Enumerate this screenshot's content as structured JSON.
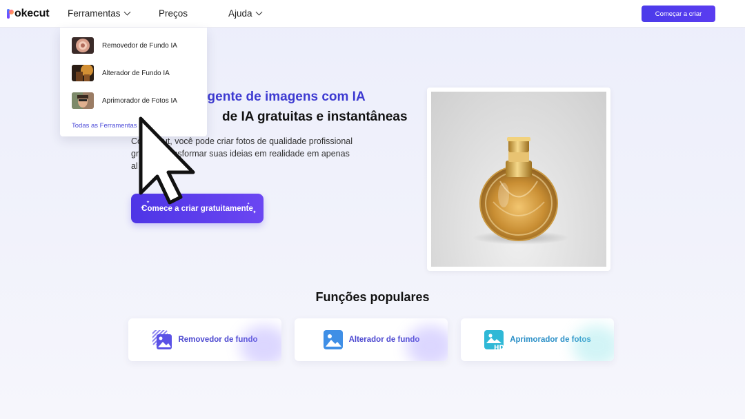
{
  "header": {
    "logo_text": "okecut",
    "nav": {
      "tools": "Ferramentas",
      "pricing": "Preços",
      "help": "Ajuda"
    },
    "cta": "Começar a criar"
  },
  "dropdown": {
    "items": [
      {
        "label": "Removedor de Fundo IA"
      },
      {
        "label": "Alterador de Fundo IA"
      },
      {
        "label": "Aprimorador de Fotos IA"
      }
    ],
    "all_tools": "Todas as Ferramentas"
  },
  "hero": {
    "title_line1": "ligente de imagens com IA",
    "title_line2": "de IA gratuitas e instantâneas",
    "desc_lines": [
      "Co            okecut, você pode criar fotos de qualidade profissional",
      "gr               nte e transformar suas ideias em realidade em apenas",
      "al                     dos."
    ],
    "cta": "Comece a criar gratuitamente"
  },
  "popular": {
    "title": "Funções populares",
    "cards": [
      {
        "label": "Removedor de fundo",
        "icon": "remove-bg-icon"
      },
      {
        "label": "Alterador de fundo",
        "icon": "change-bg-icon"
      },
      {
        "label": "Aprimorador de fotos",
        "icon": "enhance-hd-icon"
      }
    ]
  },
  "colors": {
    "accent": "#4b3bea",
    "title_accent": "#3d3ad1",
    "teal": "#2a8fc7"
  }
}
